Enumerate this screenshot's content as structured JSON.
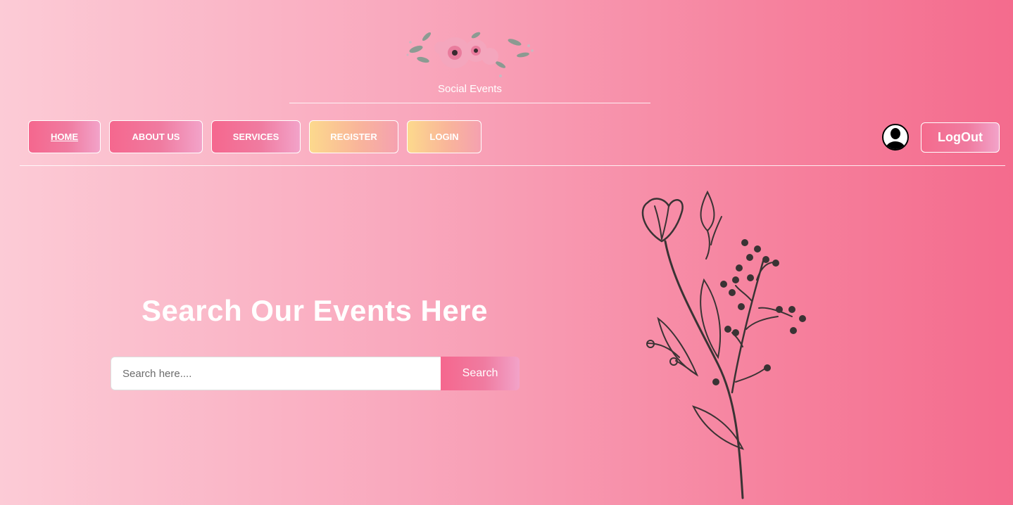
{
  "header": {
    "brand": "Social Events",
    "logo_icon": "floral-wreath-icon"
  },
  "nav": {
    "items": [
      {
        "label": "HOME",
        "active": true,
        "style": "pink"
      },
      {
        "label": "ABOUT US",
        "active": false,
        "style": "pink"
      },
      {
        "label": "SERVICES",
        "active": false,
        "style": "pink"
      },
      {
        "label": "REGISTER",
        "active": false,
        "style": "gold"
      },
      {
        "label": "LOGIN",
        "active": false,
        "style": "gold"
      }
    ],
    "avatar_icon": "user-avatar-icon",
    "logout_label": "LogOut"
  },
  "hero": {
    "title": "Search Our Events Here",
    "search_placeholder": "Search here....",
    "search_value": "",
    "search_button": "Search",
    "illustration_icon": "floral-line-art-icon"
  },
  "colors": {
    "bg_left": "#fccbd6",
    "bg_right": "#f46b8d",
    "pink_button": "#f5678e",
    "gold_button": "#fcd98d",
    "text": "#ffffff"
  }
}
